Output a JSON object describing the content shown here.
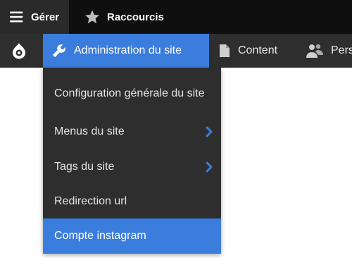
{
  "topbar": {
    "manage_label": "Gérer",
    "shortcuts_label": "Raccourcis"
  },
  "toolbar": {
    "items": [
      {
        "label": "Administration du site",
        "icon": "wrench-icon",
        "active": true
      },
      {
        "label": "Content",
        "icon": "file-icon"
      },
      {
        "label": "Pers",
        "icon": "people-icon"
      }
    ]
  },
  "dropdown": {
    "items": [
      {
        "label": "Configuration générale du site"
      },
      {
        "label": "Menus du site",
        "has_submenu": true
      },
      {
        "label": "Tags du site",
        "has_submenu": true
      },
      {
        "label": "Redirection url"
      },
      {
        "label": "Compte instagram",
        "active": true
      }
    ]
  },
  "colors": {
    "accent": "#3b7ddd",
    "toolbar_bg": "#2e2e2e",
    "topbar_bg": "#0f0f0f"
  }
}
